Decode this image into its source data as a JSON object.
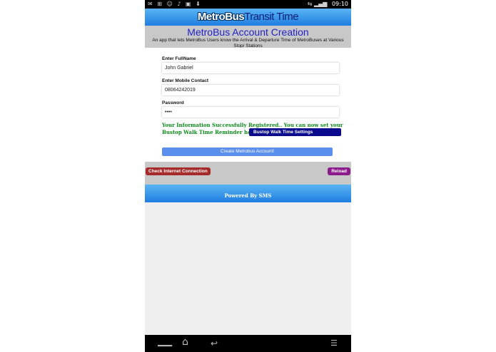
{
  "status_bar": {
    "left_icons": "✉ ⊞ ☺ ♪ ▣ ⬇",
    "right_icons": "⇆ ▂▄▆",
    "time": "09:10"
  },
  "header": {
    "title_part1": "MetroBus",
    "title_part2": "Transit Time"
  },
  "page": {
    "title": "MetroBus Account Creation",
    "description": "An app that lets MetroBus Users know the Arrival & Departure Time of MetroBuses at Various Stop/ Stations"
  },
  "form": {
    "fullname_label": "Enter FullName",
    "fullname_value": "John Gabriel",
    "mobile_label": "Enter Mobile Contact",
    "mobile_value": "08064242019",
    "password_label": "Password",
    "password_value": "••••",
    "success_message": "Your Information Successfully Registered.. You can now set your Bustop Walk Time Reminder here below",
    "walk_time_button": "Bustop Walk Time Settings",
    "create_button": "Create Metrobus Account!"
  },
  "actions": {
    "check_connection": "Check Internet Connection",
    "reload": "Reload"
  },
  "footer": {
    "text": "Powered By SMS"
  },
  "nav": {
    "back": "◁",
    "home": "⌂",
    "recent": "▭",
    "menu": "☰"
  }
}
